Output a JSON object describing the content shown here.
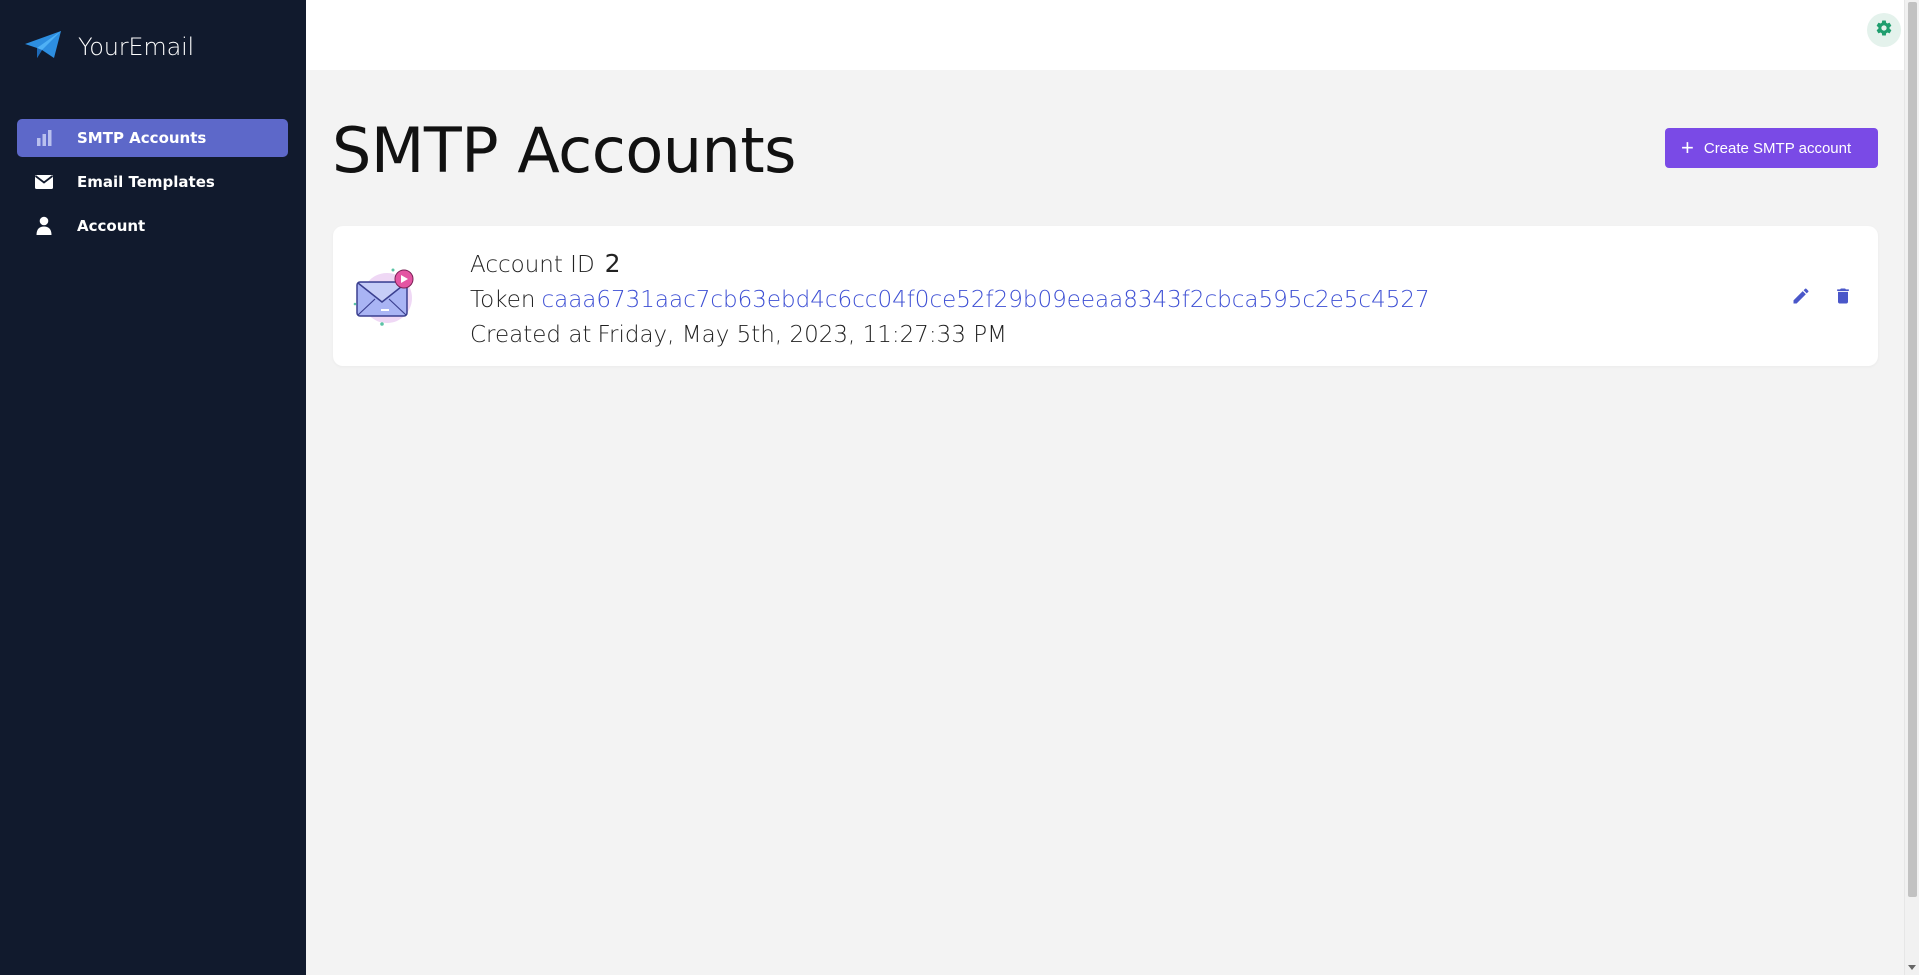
{
  "app": {
    "name": "YourEmail"
  },
  "sidebar": {
    "items": [
      {
        "label": "SMTP Accounts",
        "icon": "bar-chart-icon",
        "active": true
      },
      {
        "label": "Email Templates",
        "icon": "envelope-icon",
        "active": false
      },
      {
        "label": "Account",
        "icon": "person-icon",
        "active": false
      }
    ]
  },
  "header": {
    "settings_icon": "gear-icon"
  },
  "main": {
    "title": "SMTP Accounts",
    "create_button": {
      "label": "Create SMTP account",
      "icon": "plus-icon"
    },
    "accounts": [
      {
        "id_label": "Account ID",
        "id": "2",
        "token_label": "Token",
        "token": "caaa6731aac7cb63ebd4c6cc04f0ce52f29b09eeaa8343f2cbca595c2e5c4527",
        "created_label": "Created at",
        "created": "Friday, May 5th, 2023, 11:27:33 PM"
      }
    ]
  },
  "colors": {
    "sidebar_bg": "#111a2d",
    "active_nav": "#5d68c9",
    "primary_button": "#7a4ae6",
    "token_link": "#3d4fd4",
    "action_icon": "#4a57c9"
  }
}
